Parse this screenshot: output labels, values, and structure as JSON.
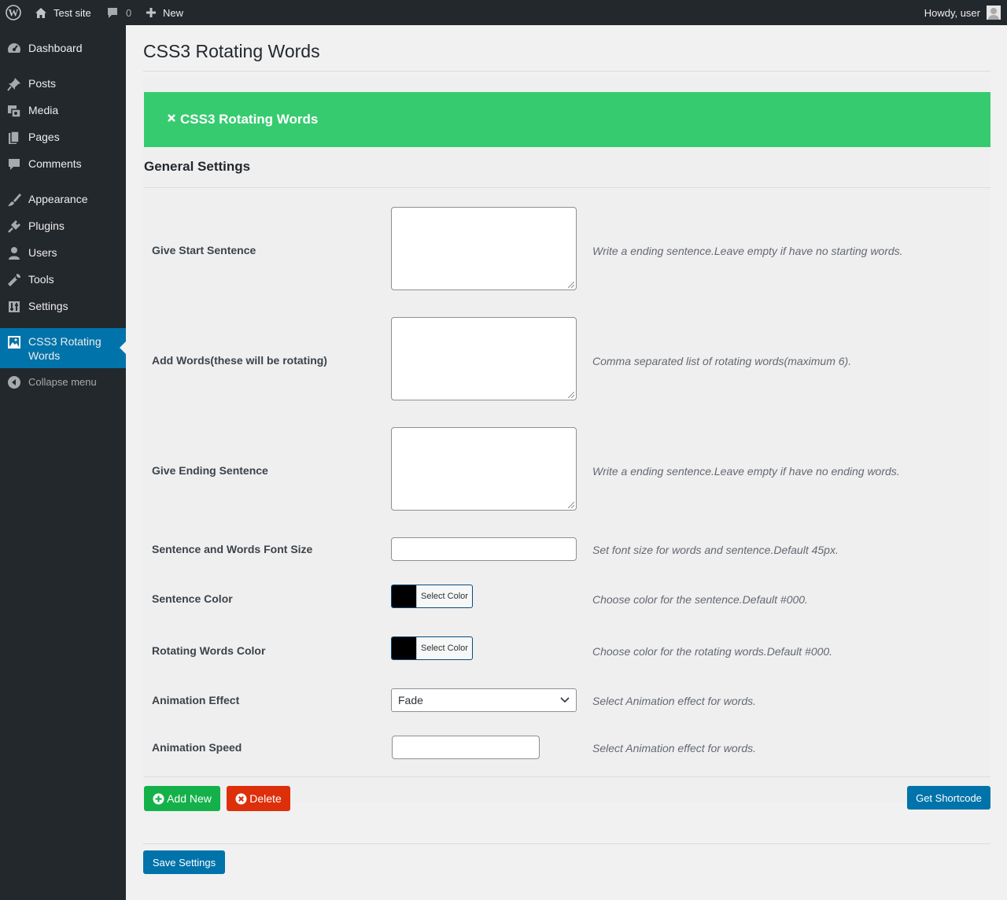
{
  "admin_bar": {
    "site_name": "Test site",
    "comments_count": "0",
    "new_label": "New",
    "howdy": "Howdy, user"
  },
  "sidebar": {
    "items": [
      {
        "label": "Dashboard",
        "icon": "dashboard-icon"
      },
      {
        "label": "Posts",
        "icon": "pin-icon"
      },
      {
        "label": "Media",
        "icon": "media-icon"
      },
      {
        "label": "Pages",
        "icon": "pages-icon"
      },
      {
        "label": "Comments",
        "icon": "comment-icon"
      },
      {
        "label": "Appearance",
        "icon": "brush-icon"
      },
      {
        "label": "Plugins",
        "icon": "plug-icon"
      },
      {
        "label": "Users",
        "icon": "user-icon"
      },
      {
        "label": "Tools",
        "icon": "wrench-icon"
      },
      {
        "label": "Settings",
        "icon": "sliders-icon"
      },
      {
        "label": "CSS3 Rotating Words",
        "icon": "image-icon",
        "current": true
      }
    ],
    "collapse_label": "Collapse menu"
  },
  "main": {
    "page_title": "CSS3 Rotating Words",
    "banner_title": "CSS3 Rotating Words",
    "section_title": "General Settings",
    "fields": {
      "start_sentence": {
        "label": "Give Start Sentence",
        "desc": "Write a ending sentence.Leave empty if have no starting words.",
        "value": ""
      },
      "words": {
        "label": "Add Words(these will be rotating)",
        "desc": "Comma separated list of rotating words(maximum 6).",
        "value": ""
      },
      "end_sentence": {
        "label": "Give Ending Sentence",
        "desc": "Write a ending sentence.Leave empty if have no ending words.",
        "value": ""
      },
      "font_size": {
        "label": "Sentence and Words Font Size",
        "desc": "Set font size for words and sentence.Default 45px.",
        "value": ""
      },
      "sentence_color": {
        "label": "Sentence Color",
        "desc": "Choose color for the sentence.Default #000.",
        "button": "Select Color",
        "color": "#000000"
      },
      "words_color": {
        "label": "Rotating Words Color",
        "desc": "Choose color for the rotating words.Default #000.",
        "button": "Select Color",
        "color": "#000000"
      },
      "animation_effect": {
        "label": "Animation Effect",
        "desc": "Select Animation effect for words.",
        "selected": "Fade"
      },
      "animation_speed": {
        "label": "Animation Speed",
        "desc": "Select Animation effect for words.",
        "value": ""
      }
    },
    "buttons": {
      "add_new": "Add New",
      "delete": "Delete",
      "shortcode": "Get Shortcode",
      "save": "Save Settings"
    }
  },
  "colors": {
    "admin_bar_bg": "#23282d",
    "accent": "#0073aa",
    "banner_green": "#37cb70",
    "add_green": "#14b14a",
    "delete_red": "#dd2f0a"
  }
}
